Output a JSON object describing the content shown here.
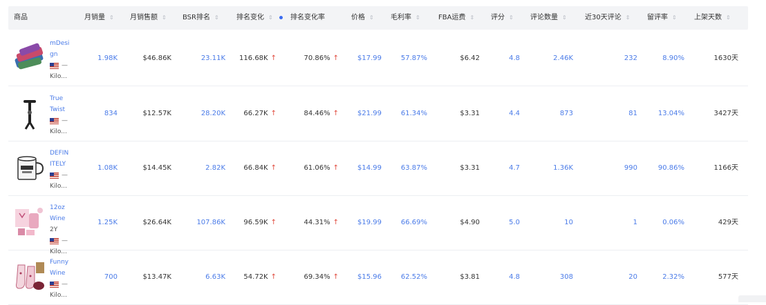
{
  "columns": [
    {
      "key": "product",
      "label": "商品",
      "sort": false
    },
    {
      "key": "month_sales",
      "label": "月销量",
      "sort": true
    },
    {
      "key": "month_revenue",
      "label": "月销售额",
      "sort": true
    },
    {
      "key": "bsr_rank",
      "label": "BSR排名",
      "sort": true
    },
    {
      "key": "rank_change",
      "label": "排名变化",
      "sort": true
    },
    {
      "key": "rank_change_rate",
      "label": "排名变化率",
      "sort": false,
      "active": true
    },
    {
      "key": "price",
      "label": "价格",
      "sort": true
    },
    {
      "key": "gross_margin",
      "label": "毛利率",
      "sort": true
    },
    {
      "key": "fba_fee",
      "label": "FBA运费",
      "sort": true
    },
    {
      "key": "rating",
      "label": "评分",
      "sort": true
    },
    {
      "key": "review_count",
      "label": "评论数量",
      "sort": true
    },
    {
      "key": "recent_reviews",
      "label": "近30天评论",
      "sort": true
    },
    {
      "key": "retention",
      "label": "留评率",
      "sort": true
    },
    {
      "key": "days_listed",
      "label": "上架天数",
      "sort": true
    }
  ],
  "rows": [
    {
      "name_lines": [
        "mDesi",
        "gn"
      ],
      "seller": "Kilo...",
      "month_sales": "1.98K",
      "month_revenue": "$46.86K",
      "bsr_rank": "23.11K",
      "rank_change": "116.68K",
      "rank_change_rate": "70.86%",
      "price": "$17.99",
      "gross_margin": "57.87%",
      "fba_fee": "$6.42",
      "rating": "4.8",
      "review_count": "2.46K",
      "recent_reviews": "232",
      "retention": "8.90%",
      "days_listed": "1630天"
    },
    {
      "name_lines": [
        "True",
        "Twist"
      ],
      "seller": "Kilo...",
      "month_sales": "834",
      "month_revenue": "$12.57K",
      "bsr_rank": "28.20K",
      "rank_change": "66.27K",
      "rank_change_rate": "84.46%",
      "price": "$21.99",
      "gross_margin": "61.34%",
      "fba_fee": "$3.31",
      "rating": "4.4",
      "review_count": "873",
      "recent_reviews": "81",
      "retention": "13.04%",
      "days_listed": "3427天"
    },
    {
      "name_lines": [
        "DEFIN",
        "ITELY"
      ],
      "seller": "Kilo...",
      "month_sales": "1.08K",
      "month_revenue": "$14.45K",
      "bsr_rank": "2.82K",
      "rank_change": "66.84K",
      "rank_change_rate": "61.06%",
      "price": "$14.99",
      "gross_margin": "63.87%",
      "fba_fee": "$3.31",
      "rating": "4.7",
      "review_count": "1.36K",
      "recent_reviews": "990",
      "retention": "90.86%",
      "days_listed": "1166天"
    },
    {
      "name_lines": [
        "12oz",
        "Wine",
        "2Y"
      ],
      "seller": "Kilo...",
      "month_sales": "1.25K",
      "month_revenue": "$26.64K",
      "bsr_rank": "107.86K",
      "rank_change": "96.59K",
      "rank_change_rate": "44.31%",
      "price": "$19.99",
      "gross_margin": "66.69%",
      "fba_fee": "$4.90",
      "rating": "5.0",
      "review_count": "10",
      "recent_reviews": "1",
      "retention": "0.06%",
      "days_listed": "429天"
    },
    {
      "name_lines": [
        "Funny",
        "Wine"
      ],
      "seller": "Kilo...",
      "month_sales": "700",
      "month_revenue": "$13.47K",
      "bsr_rank": "6.63K",
      "rank_change": "54.72K",
      "rank_change_rate": "69.34%",
      "price": "$15.96",
      "gross_margin": "62.52%",
      "fba_fee": "$3.81",
      "rating": "4.8",
      "review_count": "308",
      "recent_reviews": "20",
      "retention": "2.32%",
      "days_listed": "577天"
    }
  ],
  "dash_text": "—"
}
